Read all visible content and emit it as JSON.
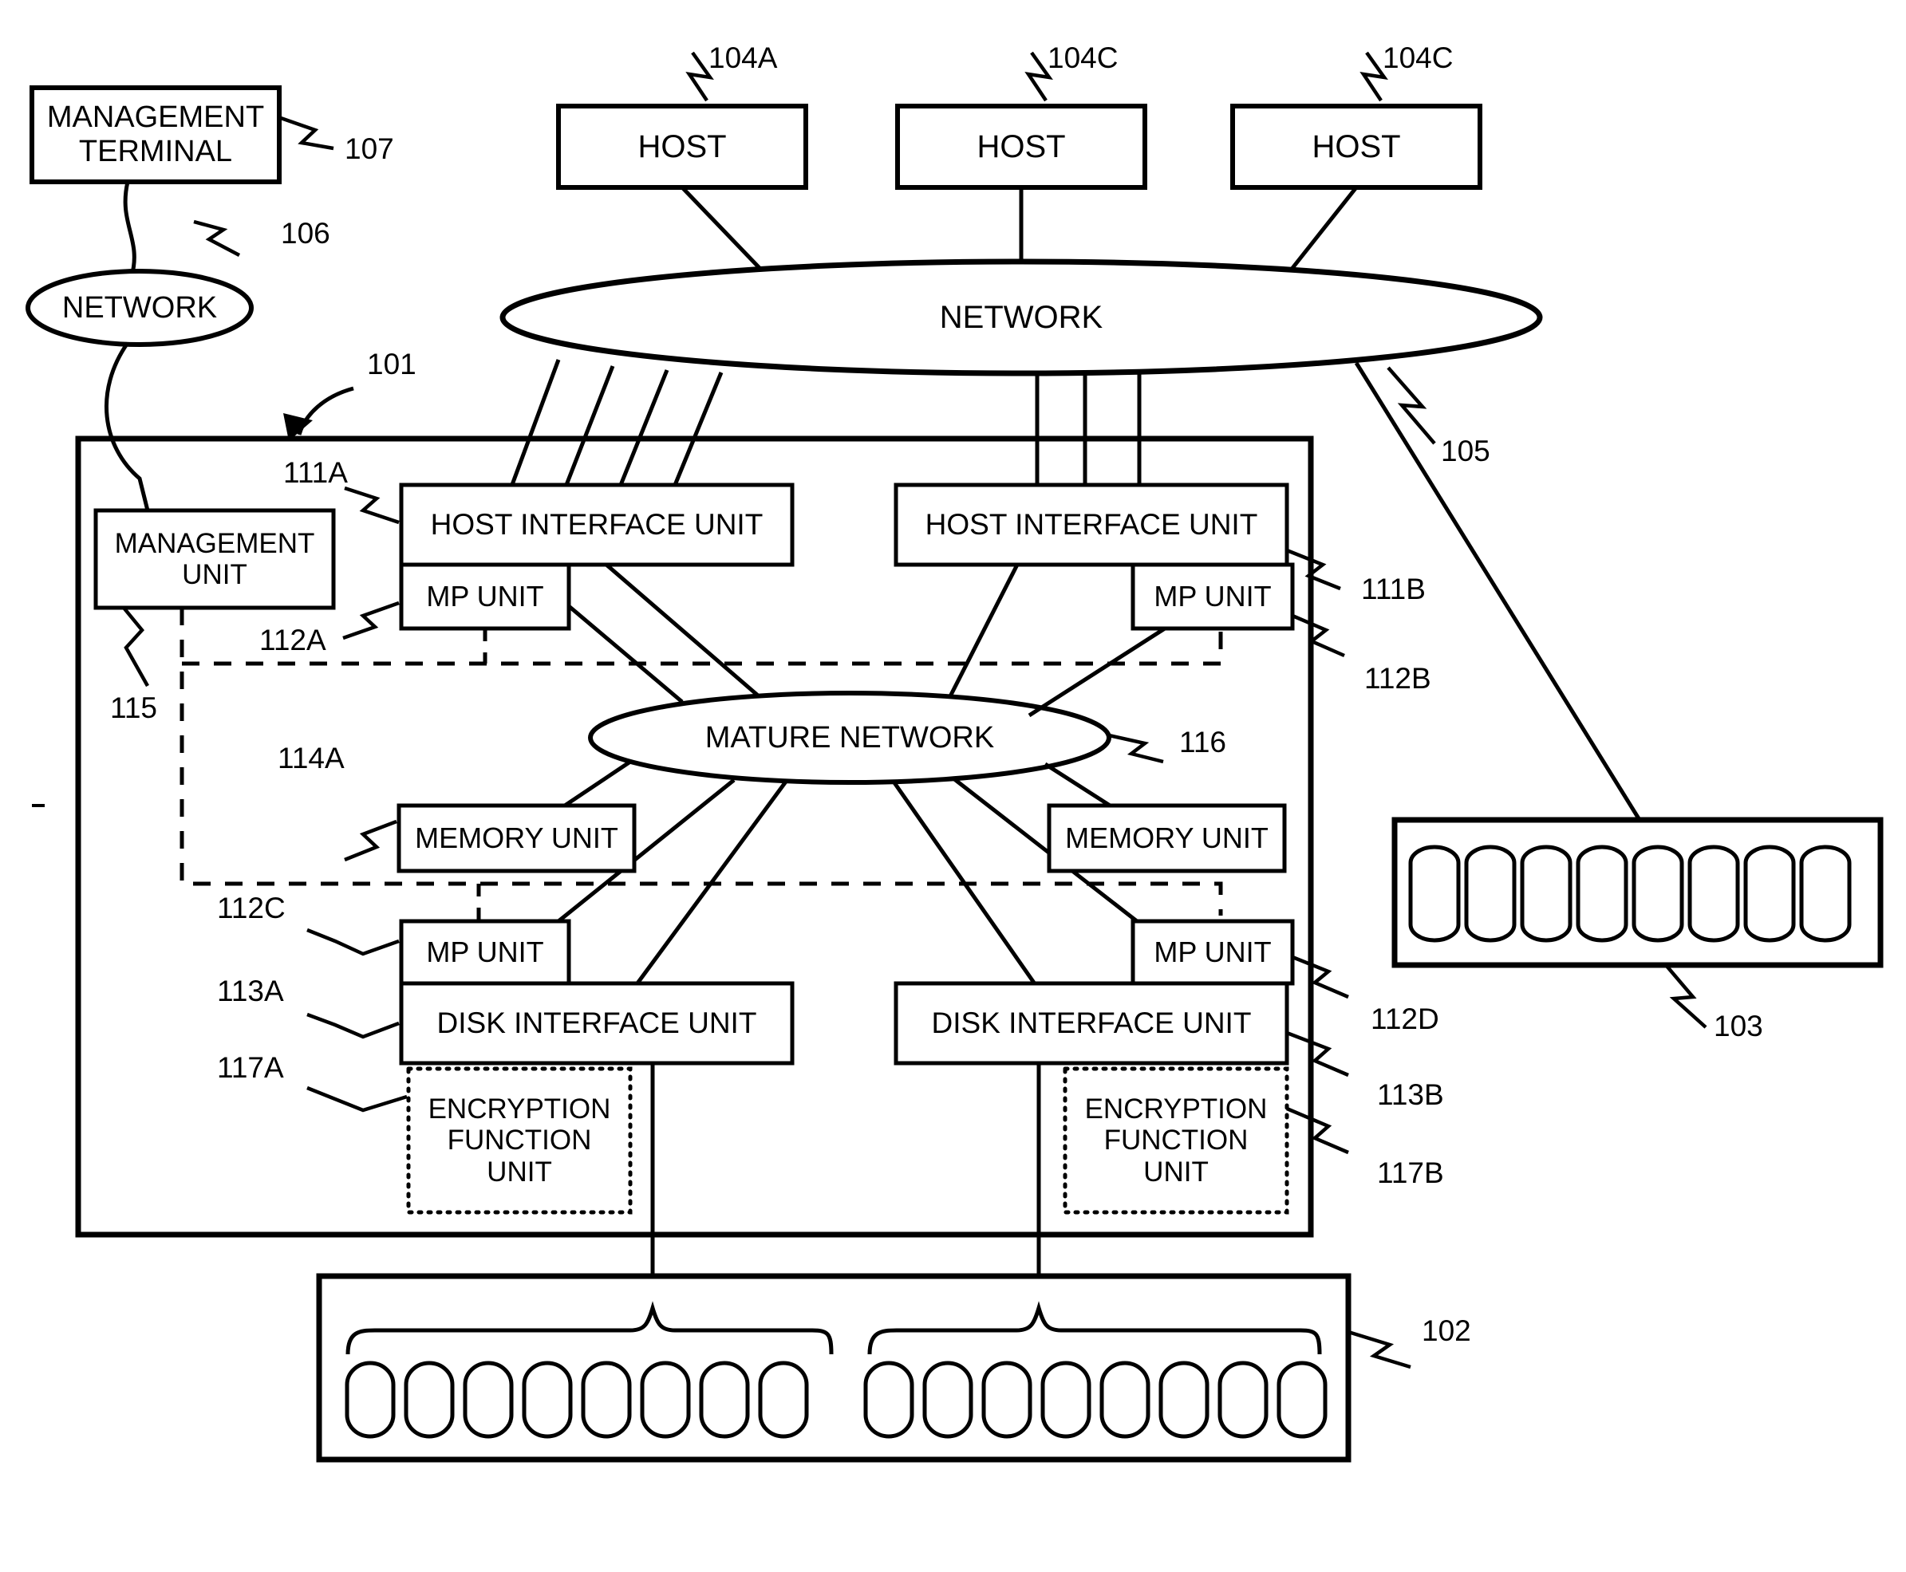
{
  "figure": {
    "type": "patent-block-diagram",
    "description": "Storage system block diagram with hosts, networks, host interface units, MP units, memory units, disk interface units with encryption function units, and disk enclosures"
  },
  "nodes": {
    "management_terminal": {
      "label": "MANAGEMENT\nTERMINAL",
      "line1": "MANAGEMENT",
      "line2": "TERMINAL",
      "ref": "107"
    },
    "network_left": {
      "label": "NETWORK",
      "ref": "106"
    },
    "network_top": {
      "label": "NETWORK",
      "ref": "105"
    },
    "hosts": [
      {
        "label": "HOST",
        "ref": "104A"
      },
      {
        "label": "HOST",
        "ref": "104C"
      },
      {
        "label": "HOST",
        "ref": "104C"
      }
    ],
    "storage_system": {
      "ref": "101"
    },
    "management_unit": {
      "line1": "MANAGEMENT",
      "line2": "UNIT",
      "ref": "115"
    },
    "host_interface_units": [
      {
        "label": "HOST INTERFACE UNIT",
        "ref": "111A"
      },
      {
        "label": "HOST INTERFACE UNIT",
        "ref": "111B"
      }
    ],
    "mp_units": [
      {
        "label": "MP UNIT",
        "ref": "112A"
      },
      {
        "label": "MP UNIT",
        "ref": "112B"
      },
      {
        "label": "MP UNIT",
        "ref": "112C"
      },
      {
        "label": "MP UNIT",
        "ref": "112D"
      }
    ],
    "mature_network": {
      "label": "MATURE NETWORK",
      "ref": "116"
    },
    "memory_units": [
      {
        "label": "MEMORY UNIT",
        "ref": "114A"
      },
      {
        "label": "MEMORY UNIT",
        "ref": ""
      }
    ],
    "disk_interface_units": [
      {
        "label": "DISK INTERFACE UNIT",
        "ref": "113A"
      },
      {
        "label": "DISK INTERFACE UNIT",
        "ref": "113B"
      }
    ],
    "encryption_function_units": [
      {
        "line1": "ENCRYPTION",
        "line2": "FUNCTION",
        "line3": "UNIT",
        "ref": "117A"
      },
      {
        "line1": "ENCRYPTION",
        "line2": "FUNCTION",
        "line3": "UNIT",
        "ref": "117B"
      }
    ],
    "disk_enclosure_right": {
      "ref": "103",
      "disk_count": 8
    },
    "disk_enclosure_bottom": {
      "ref": "102",
      "disk_count_left_group": 8,
      "disk_count_right_group": 8
    }
  },
  "reference_numerals": {
    "r101": "101",
    "r102": "102",
    "r103": "103",
    "r104A": "104A",
    "r104C_1": "104C",
    "r104C_2": "104C",
    "r105": "105",
    "r106": "106",
    "r107": "107",
    "r111A": "111A",
    "r111B": "111B",
    "r112A": "112A",
    "r112B": "112B",
    "r112C": "112C",
    "r112D": "112D",
    "r113A": "113A",
    "r113B": "113B",
    "r114A": "114A",
    "r115": "115",
    "r116": "116",
    "r117A": "117A",
    "r117B": "117B"
  },
  "colors": {
    "stroke": "#000000",
    "background": "#ffffff"
  }
}
